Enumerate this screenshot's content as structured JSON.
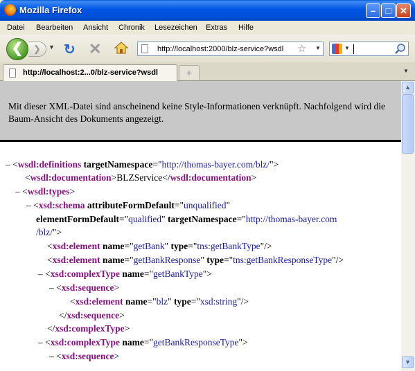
{
  "window": {
    "title": "Mozilla Firefox"
  },
  "menu": [
    "Datei",
    "Bearbeiten",
    "Ansicht",
    "Chronik",
    "Lesezeichen",
    "Extras",
    "Hilfe"
  ],
  "navigation": {
    "url": "http://localhost:2000/blz-service?wsdl"
  },
  "tab": {
    "label": "http://localhost:2...0/blz-service?wsdl",
    "new_tab_symbol": "+"
  },
  "info_message": "Mit dieser XML-Datei sind anscheinend keine Style-Informationen verknüpft. Nachfolgend wird die Baum-Ansicht des Dokuments angezeigt.",
  "tree": {
    "l1_toggle": "–",
    "l1_tag": "wsdl:definitions",
    "l1_attr": "targetNamespace",
    "l1_val": "http://thomas-bayer.com/blz/",
    "l2_tag": "wsdl:documentation",
    "l2_text": "BLZService",
    "l3_toggle": "–",
    "l3_tag": "wsdl:types",
    "l4_toggle": "–",
    "l4_tag": "xsd:schema",
    "l4_attr": "attributeFormDefault",
    "l4_val": "unqualified",
    "l5_attr1": "elementFormDefault",
    "l5_val1": "qualified",
    "l5_attr2": "targetNamespace",
    "l5_val2a": "http://thomas-bayer.com",
    "l5_val2b": "/blz/",
    "e1_tag": "xsd:element",
    "e1_a1": "name",
    "e1_v1": "getBank",
    "e1_a2": "type",
    "e1_v2": "tns:getBankType",
    "e2_tag": "xsd:element",
    "e2_a1": "name",
    "e2_v1": "getBankResponse",
    "e2_a2": "type",
    "e2_v2": "tns:getBankResponseType",
    "c1_toggle": "–",
    "c1_tag": "xsd:complexType",
    "c1_attr": "name",
    "c1_val": "getBankType",
    "s1_toggle": "–",
    "s1_tag": "xsd:sequence",
    "e3_tag": "xsd:element",
    "e3_a1": "name",
    "e3_v1": "blz",
    "e3_a2": "type",
    "e3_v2": "xsd:string",
    "s1_close": "xsd:sequence",
    "c1_close": "xsd:complexType",
    "c2_toggle": "–",
    "c2_tag": "xsd:complexType",
    "c2_attr": "name",
    "c2_val": "getBankResponseType",
    "s2_toggle": "–",
    "s2_tag": "xsd:sequence"
  },
  "colors": {
    "tag": "#881280",
    "attr_value": "#1a1aa6",
    "info_bg": "#c8c8c8"
  }
}
